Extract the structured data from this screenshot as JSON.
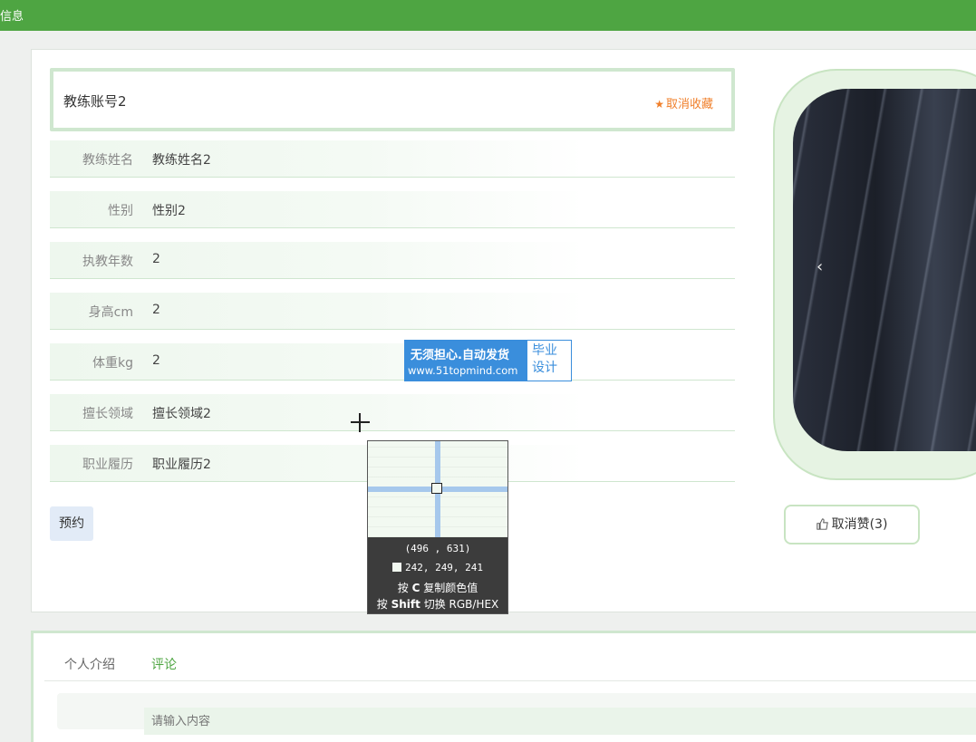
{
  "topbar": {
    "title": "信息",
    "color": "#4ea542"
  },
  "detail": {
    "name": "教练账号2",
    "favorite_icon": "star-icon",
    "favorite_label": "取消收藏",
    "fields": [
      {
        "label": "教练姓名",
        "value": "教练姓名2"
      },
      {
        "label": "性别",
        "value": "性别2"
      },
      {
        "label": "执教年数",
        "value": "2"
      },
      {
        "label": "身高cm",
        "value": "2"
      },
      {
        "label": "体重kg",
        "value": "2"
      },
      {
        "label": "擅长领域",
        "value": "擅长领域2"
      },
      {
        "label": "职业履历",
        "value": "职业履历2"
      }
    ],
    "book_button": "预约"
  },
  "carousel": {
    "prev_glyph": "‹"
  },
  "like": {
    "icon": "thumbs-up-icon",
    "label": "取消赞(3)"
  },
  "tabs": [
    {
      "label": "个人介绍"
    },
    {
      "label": "评论"
    }
  ],
  "comment": {
    "placeholder": "请输入内容"
  },
  "watermark": {
    "line1": "无须担心.自动发货",
    "line2": "www.51topmind.com",
    "right1": "毕业",
    "right2": "设计"
  },
  "color_picker": {
    "coords": "(496 , 631)",
    "rgb": "242, 249, 241",
    "tip_copy_prefix": "按",
    "tip_copy_key": "C",
    "tip_copy_suffix": "复制颜色值",
    "tip_toggle_prefix": "按",
    "tip_toggle_key": "Shift",
    "tip_toggle_suffix": "切换 RGB/HEX"
  }
}
